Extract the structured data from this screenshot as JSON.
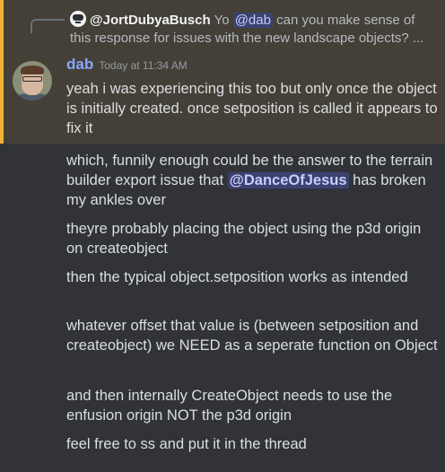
{
  "reply": {
    "author": "@JortDubyaBusch",
    "text_before": "Yo ",
    "mention": "@dab",
    "text_after": " can you make sense of this response for issues with the new landscape objects? ..."
  },
  "message": {
    "author": "dab",
    "timestamp": "Today at 11:34 AM",
    "accent_color": "#86a8ff",
    "highlight_border": "#f0b232"
  },
  "lines": [
    {
      "text": "yeah i was experiencing this too but only once the object is initially created. once setposition is called it appears to fix it"
    },
    {
      "text_before": "which, funnily enough could be the answer to the terrain builder export issue that ",
      "mention": "@DanceOfJesus",
      "text_after": " has broken my ankles over"
    },
    {
      "text": "theyre probably placing the object using the p3d origin on createobject"
    },
    {
      "text": "then the typical object.setposition works as intended"
    },
    {
      "text": "whatever offset that value is (between setposition and createobject) we NEED as a seperate function on Object"
    },
    {
      "text": "and then internally CreateObject needs to use the enfusion origin NOT the p3d origin"
    },
    {
      "text": "feel free to ss and put it in the thread"
    }
  ]
}
